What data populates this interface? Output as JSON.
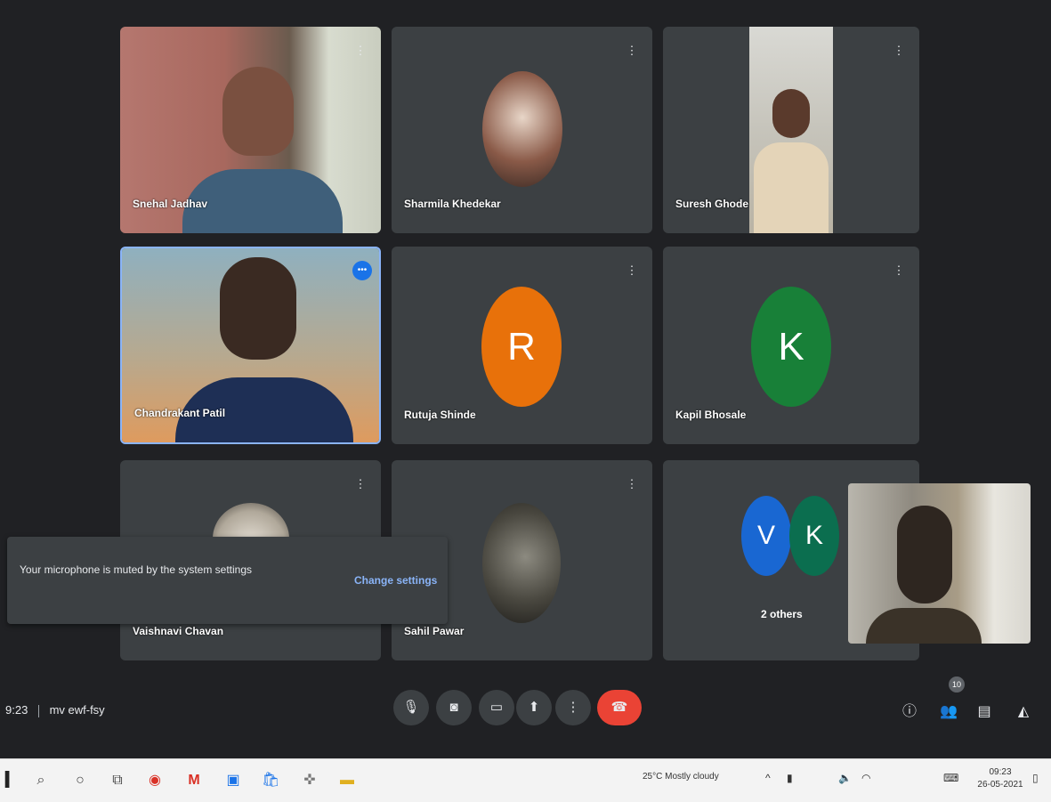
{
  "meeting": {
    "time": "9:23",
    "code": "mv ewf-fsy"
  },
  "participants": [
    {
      "name": "Snehal Jadhav"
    },
    {
      "name": "Sharmila Khedekar"
    },
    {
      "name": "Suresh Ghode"
    },
    {
      "name": "Chandrakant Patil"
    },
    {
      "name": "Rutuja Shinde",
      "initial": "R"
    },
    {
      "name": "Kapil Bhosale",
      "initial": "K"
    },
    {
      "name": "Vaishnavi Chavan"
    },
    {
      "name": "Sahil Pawar"
    },
    {
      "name": "2 others",
      "initials": [
        "V",
        "K"
      ]
    }
  ],
  "toast": {
    "text": "Your microphone is muted by the system settings",
    "action": "Change settings"
  },
  "colors": {
    "meet_bg": "#202124",
    "tile_bg": "#3c4043",
    "end_call": "#ea4335",
    "avatar_orange": "#e8710a",
    "avatar_green": "#188038",
    "avatar_blue": "#1967d2",
    "avatar_teal": "#0b6e4f"
  },
  "controls": [
    "microphone-icon",
    "camera-icon",
    "captions-icon",
    "present-icon",
    "more-icon",
    "end-call-icon"
  ],
  "right_controls": [
    "info-icon",
    "people-icon",
    "chat-icon",
    "activities-icon"
  ],
  "people_count": "10",
  "taskbar": {
    "tray_text": "25°C Mostly cloudy",
    "clock_time": "09:23",
    "clock_date": "26-05-2021"
  }
}
